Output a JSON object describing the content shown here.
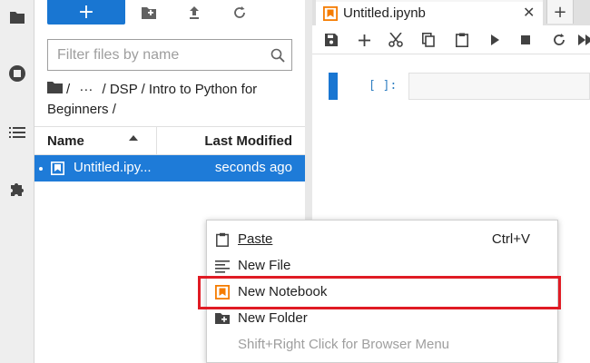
{
  "colors": {
    "accent": "#1976d2",
    "selection": "#1e7bd8",
    "notebook_icon": "#f57c00",
    "highlight": "#e01b24"
  },
  "activity_bar": {
    "icons": [
      "folder-icon",
      "running-icon",
      "toc-icon",
      "extension-icon"
    ]
  },
  "filebrowser": {
    "toolbar": {
      "new_label": "+"
    },
    "filter": {
      "placeholder": "Filter files by name",
      "value": ""
    },
    "breadcrumb": {
      "sep1": "/",
      "ellipsis": "···",
      "path": "/ DSP / Intro to Python for Beginners /"
    },
    "columns": {
      "name": "Name",
      "modified": "Last Modified"
    },
    "files": [
      {
        "name": "Untitled.ipy...",
        "modified": "seconds ago",
        "selected": true,
        "running": true
      }
    ]
  },
  "notebook": {
    "tab": {
      "title": "Untitled.ipynb",
      "close": "✕",
      "add": "+"
    },
    "cell": {
      "prompt": "[ ]:"
    }
  },
  "context_menu": {
    "items": [
      {
        "label": "Paste",
        "shortcut": "Ctrl+V",
        "icon": "paste-icon",
        "disabled": false
      },
      {
        "label": "New File",
        "shortcut": "",
        "icon": "text-file-icon",
        "disabled": false
      },
      {
        "label": "New Notebook",
        "shortcut": "",
        "icon": "notebook-icon",
        "disabled": false,
        "highlighted": true
      },
      {
        "label": "New Folder",
        "shortcut": "",
        "icon": "new-folder-icon",
        "disabled": false
      },
      {
        "label": "Shift+Right Click for Browser Menu",
        "shortcut": "",
        "icon": "",
        "disabled": true
      }
    ]
  }
}
